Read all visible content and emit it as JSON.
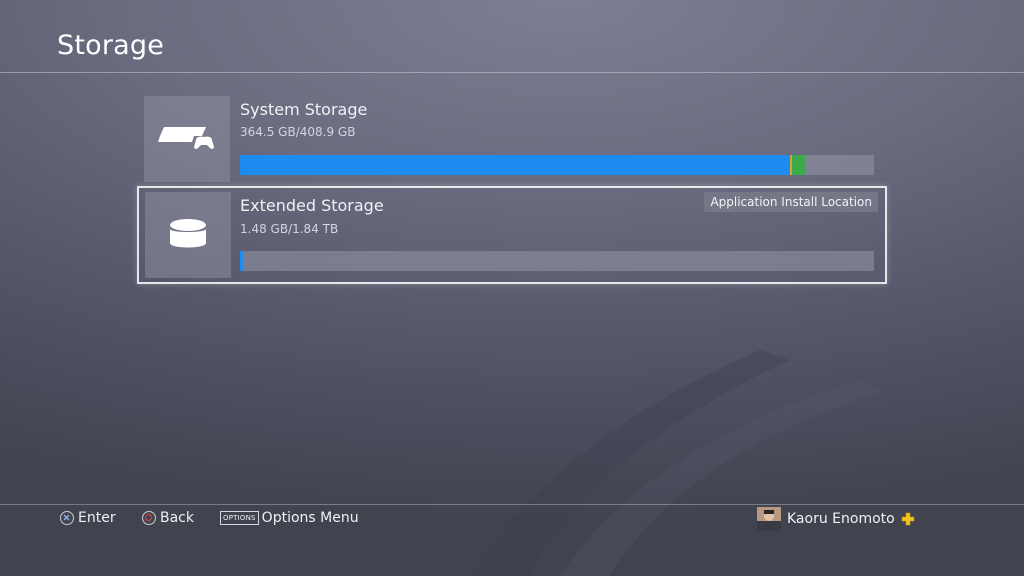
{
  "header": {
    "title": "Storage"
  },
  "storages": [
    {
      "name": "System Storage",
      "usage": "364.5 GB/408.9 GB",
      "icon": "console-controller-icon",
      "used_fraction": 0.891,
      "segments": [
        {
          "color": "#1e8bf0",
          "fraction": 0.868
        },
        {
          "color": "#e0a030",
          "fraction": 0.003
        },
        {
          "color": "#3caa4a",
          "fraction": 0.02
        }
      ]
    },
    {
      "name": "Extended Storage",
      "usage": "1.48 GB/1.84 TB",
      "icon": "external-drive-icon",
      "badge": "Application Install Location",
      "used_fraction": 0.005,
      "segments": [
        {
          "color": "#1e8bf0",
          "fraction": 0.005
        }
      ]
    }
  ],
  "footer": {
    "enter_label": "Enter",
    "back_label": "Back",
    "options_key": "OPTIONS",
    "options_label": "Options Menu"
  },
  "user": {
    "name": "Kaoru Enomoto",
    "plus_color": "#f2c31c"
  },
  "colors": {
    "accent": "#1e8bf0",
    "circle_button": "#e2472a"
  }
}
